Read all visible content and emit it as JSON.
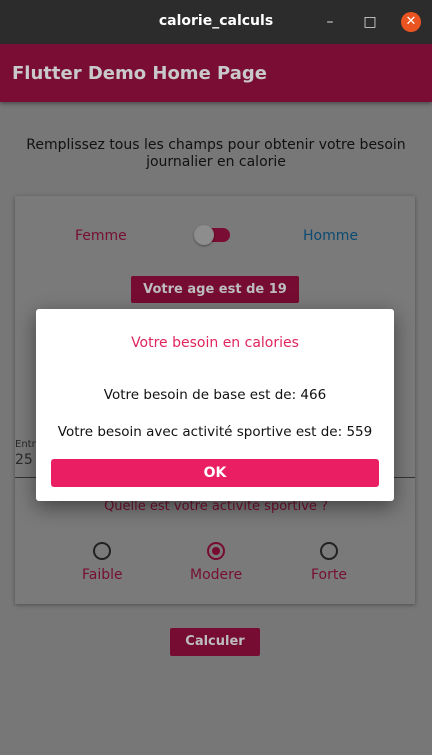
{
  "window": {
    "title": "calorie_calculs",
    "minimize_glyph": "–",
    "maximize_glyph": "□",
    "close_glyph": "✕"
  },
  "appbar": {
    "title": "Flutter Demo Home Page"
  },
  "intro": {
    "text": "Remplissez tous les champs pour obtenir votre besoin journalier en calorie"
  },
  "gender": {
    "female_label": "Femme",
    "male_label": "Homme",
    "switch_on": false
  },
  "age_button": {
    "label": "Votre age est de 19"
  },
  "field": {
    "label": "Entr",
    "value": "25"
  },
  "activity": {
    "question": "Quelle est votre activité sportive ?",
    "options": [
      "Faible",
      "Modere",
      "Forte"
    ],
    "selected": "Modere"
  },
  "calc_button": {
    "label": "Calculer"
  },
  "dialog": {
    "title": "Votre besoin en calories",
    "base_text": "Votre besoin de base est de: 466",
    "activity_text": "Votre besoin avec activité sportive est de: 559",
    "ok_label": "OK"
  },
  "colors": {
    "primary": "#7a0d33",
    "accent": "#e91e63",
    "dialog_title": "#e0245e",
    "window_close": "#e95420"
  }
}
